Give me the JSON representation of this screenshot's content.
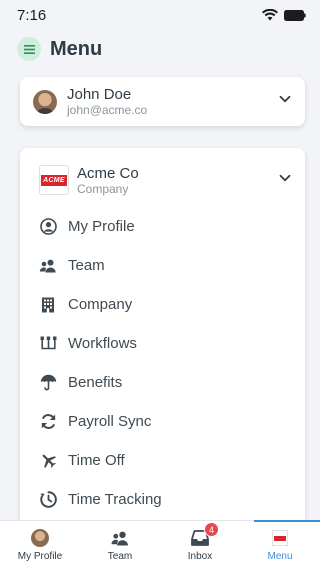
{
  "status": {
    "time": "7:16"
  },
  "header": {
    "title": "Menu",
    "icon": "menu-list-icon"
  },
  "user": {
    "name": "John Doe",
    "email": "john@acme.co"
  },
  "company": {
    "name": "Acme Co",
    "subtitle": "Company",
    "logo_text": "ACME"
  },
  "menu": {
    "items": [
      {
        "label": "My Profile",
        "icon": "profile-icon"
      },
      {
        "label": "Team",
        "icon": "team-icon"
      },
      {
        "label": "Company",
        "icon": "building-icon"
      },
      {
        "label": "Workflows",
        "icon": "workflow-icon"
      },
      {
        "label": "Benefits",
        "icon": "umbrella-icon"
      },
      {
        "label": "Payroll Sync",
        "icon": "sync-icon"
      },
      {
        "label": "Time Off",
        "icon": "plane-icon"
      },
      {
        "label": "Time Tracking",
        "icon": "clock-icon"
      }
    ]
  },
  "tabs": [
    {
      "label": "My Profile",
      "icon": "avatar-icon"
    },
    {
      "label": "Team",
      "icon": "team-icon"
    },
    {
      "label": "Inbox",
      "icon": "inbox-icon",
      "badge": "4"
    },
    {
      "label": "Menu",
      "icon": "acme-logo-icon",
      "active": true
    }
  ],
  "colors": {
    "accent": "#3d8fd8",
    "badge": "#e5484d",
    "menu_badge_bg": "#cfeedd",
    "logo_red": "#d7262d"
  }
}
